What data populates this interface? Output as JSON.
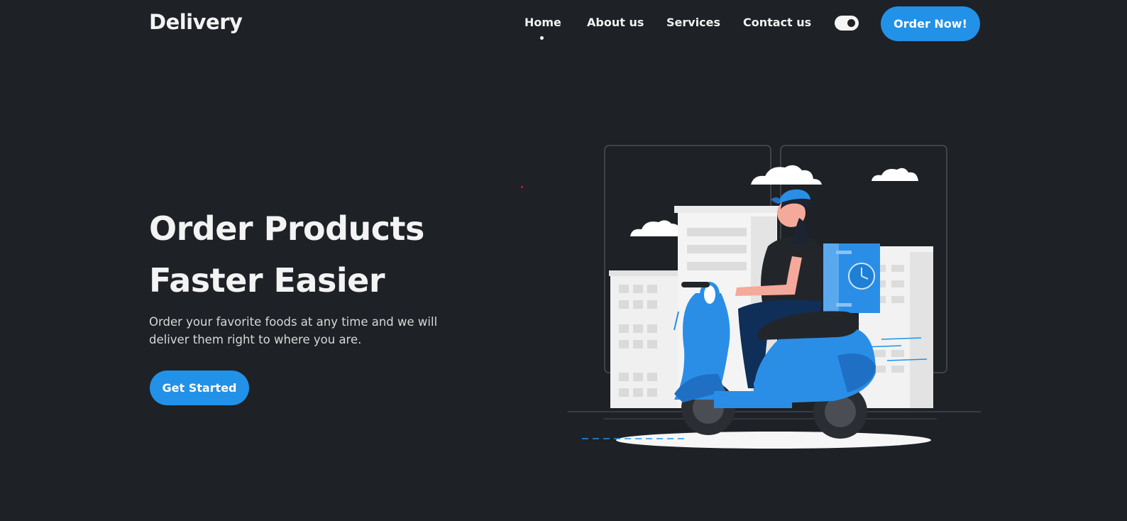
{
  "header": {
    "logo": "Delivery",
    "nav": {
      "home": "Home",
      "about": "About us",
      "services": "Services",
      "contact": "Contact us"
    },
    "active": "Home",
    "order_button": "Order Now!"
  },
  "hero": {
    "title_line1": "Order Products",
    "title_line2": "Faster Easier",
    "description": "Order your favorite foods at any time and we will deliver them right to where you are.",
    "cta": "Get Started",
    "illustration": "delivery-scooter-illustration"
  },
  "colors": {
    "background": "#1e2125",
    "accent": "#2291e8",
    "text": "#f3f3f3"
  }
}
